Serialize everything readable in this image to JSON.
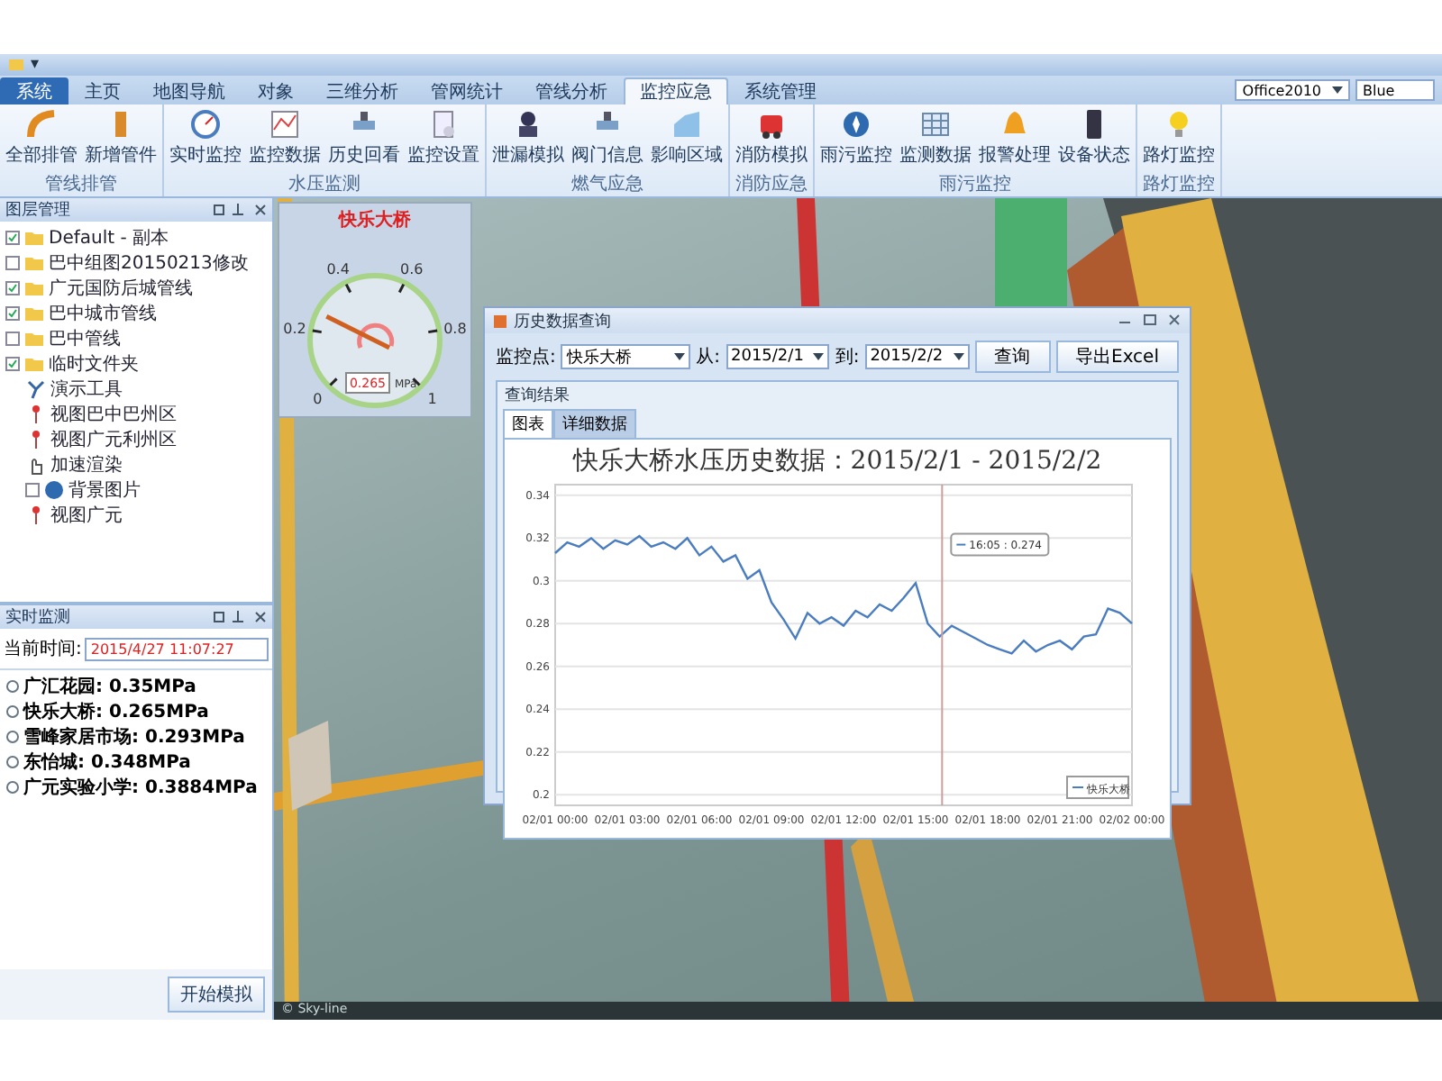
{
  "window": {
    "quick_access": [
      "▾"
    ],
    "skin": "Office2010",
    "scheme": "Blue"
  },
  "ribbon": {
    "tabs": [
      {
        "label": "系统",
        "selected": false,
        "kind": "file"
      },
      {
        "label": "主页",
        "selected": false,
        "kind": "tab"
      },
      {
        "label": "地图导航",
        "selected": false,
        "kind": "tab"
      },
      {
        "label": "对象",
        "selected": false,
        "kind": "tab"
      },
      {
        "label": "三维分析",
        "selected": false,
        "kind": "tab"
      },
      {
        "label": "管网统计",
        "selected": false,
        "kind": "tab"
      },
      {
        "label": "管线分析",
        "selected": false,
        "kind": "tab"
      },
      {
        "label": "监控应急",
        "selected": true,
        "kind": "tab"
      },
      {
        "label": "系统管理",
        "selected": false,
        "kind": "tab"
      }
    ],
    "groups": [
      {
        "label": "管线排管",
        "buttons": [
          "全部排管",
          "新增管件"
        ]
      },
      {
        "label": "水压监测",
        "buttons": [
          "实时监控",
          "监控数据",
          "历史回看",
          "监控设置"
        ]
      },
      {
        "label": "燃气应急",
        "buttons": [
          "泄漏模拟",
          "阀门信息",
          "影响区域"
        ]
      },
      {
        "label": "消防应急",
        "buttons": [
          "消防模拟"
        ]
      },
      {
        "label": "雨污监控",
        "buttons": [
          "雨污监控",
          "监测数据",
          "报警处理",
          "设备状态"
        ]
      },
      {
        "label": "路灯监控",
        "buttons": [
          "路灯监控"
        ]
      }
    ]
  },
  "layer_panel": {
    "title": "图层管理",
    "items": [
      {
        "label": "Default - 副本",
        "kind": "folder",
        "checked": true
      },
      {
        "label": "巴中组图20150213修改",
        "kind": "folder",
        "checked": false
      },
      {
        "label": "广元国防后城管线",
        "kind": "folder",
        "checked": true
      },
      {
        "label": "巴中城市管线",
        "kind": "folder",
        "checked": true
      },
      {
        "label": "巴中管线",
        "kind": "folder",
        "checked": false
      },
      {
        "label": "临时文件夹",
        "kind": "folder",
        "checked": true
      },
      {
        "label": "演示工具",
        "kind": "tool"
      },
      {
        "label": "视图巴中巴州区",
        "kind": "pin"
      },
      {
        "label": "视图广元利州区",
        "kind": "pin"
      },
      {
        "label": "加速渲染",
        "kind": "hand"
      },
      {
        "label": "背景图片",
        "kind": "globe",
        "checked": false
      },
      {
        "label": "视图广元",
        "kind": "pin"
      }
    ]
  },
  "monitor_panel": {
    "title": "实时监测",
    "time_label": "当前时间:",
    "time": "2015/4/27 11:07:27",
    "readings": [
      "广汇花园: 0.35MPa",
      "快乐大桥: 0.265MPa",
      "雪峰家居市场: 0.293MPa",
      "东怡城: 0.348MPa",
      "广元实验小学: 0.3884MPa"
    ],
    "button": "开始模拟"
  },
  "gauge": {
    "title": "快乐大桥",
    "ticks": [
      "0",
      "0.2",
      "0.4",
      "0.6",
      "0.8",
      "1"
    ],
    "level": 0.265,
    "reading": "0.265",
    "unit": "MPa"
  },
  "dialog": {
    "title": "历史数据查询",
    "point_label": "监控点:",
    "point": "快乐大桥",
    "from_label": "从:",
    "from": "2015/2/1",
    "to_label": "到:",
    "to": "2015/2/2",
    "query_button": "查询",
    "export_button": "导出Excel",
    "group_title": "查询结果",
    "tabs": [
      {
        "label": "图表",
        "selected": true
      },
      {
        "label": "详细数据",
        "selected": false
      }
    ],
    "chart_data": {
      "type": "line",
      "title": "快乐大桥水压历史数据：2015/2/1 - 2015/2/2",
      "categories": [
        "02/01 00:00",
        null,
        null,
        null,
        null,
        null,
        "02/01 03:00",
        null,
        null,
        null,
        null,
        null,
        "02/01 06:00",
        null,
        null,
        null,
        null,
        null,
        "02/01 09:00",
        null,
        null,
        null,
        null,
        null,
        "02/01 12:00",
        null,
        null,
        null,
        null,
        null,
        "02/01 15:00",
        null,
        null,
        null,
        null,
        null,
        "02/01 18:00",
        null,
        null,
        null,
        null,
        null,
        "02/01 21:00",
        null,
        null,
        null,
        null,
        null,
        "02/02 00:00"
      ],
      "series": [
        {
          "name": "快乐大桥",
          "color": "#4a7cc0",
          "values": [
            0.313,
            0.318,
            0.316,
            0.32,
            0.315,
            0.319,
            0.317,
            0.321,
            0.316,
            0.318,
            0.315,
            0.32,
            0.312,
            0.316,
            0.309,
            0.312,
            0.301,
            0.305,
            0.29,
            0.282,
            0.273,
            0.285,
            0.28,
            0.283,
            0.279,
            0.286,
            0.283,
            0.289,
            0.286,
            0.292,
            0.299,
            0.28,
            0.274,
            0.279,
            0.276,
            0.273,
            0.27,
            0.268,
            0.266,
            0.272,
            0.267,
            0.27,
            0.272,
            0.268,
            0.274,
            0.275,
            0.287,
            0.285,
            0.28
          ]
        }
      ],
      "ylim": [
        0.195,
        0.345
      ],
      "grid": true,
      "yticks": [
        0.2,
        0.22,
        0.24,
        0.26,
        0.28,
        {
          "value": 0.3,
          "label": "0.3"
        },
        0.32,
        0.34
      ],
      "annotations": [
        "16:05 : 0.274"
      ]
    }
  },
  "status_bar": {
    "text": "© Sky-line"
  }
}
